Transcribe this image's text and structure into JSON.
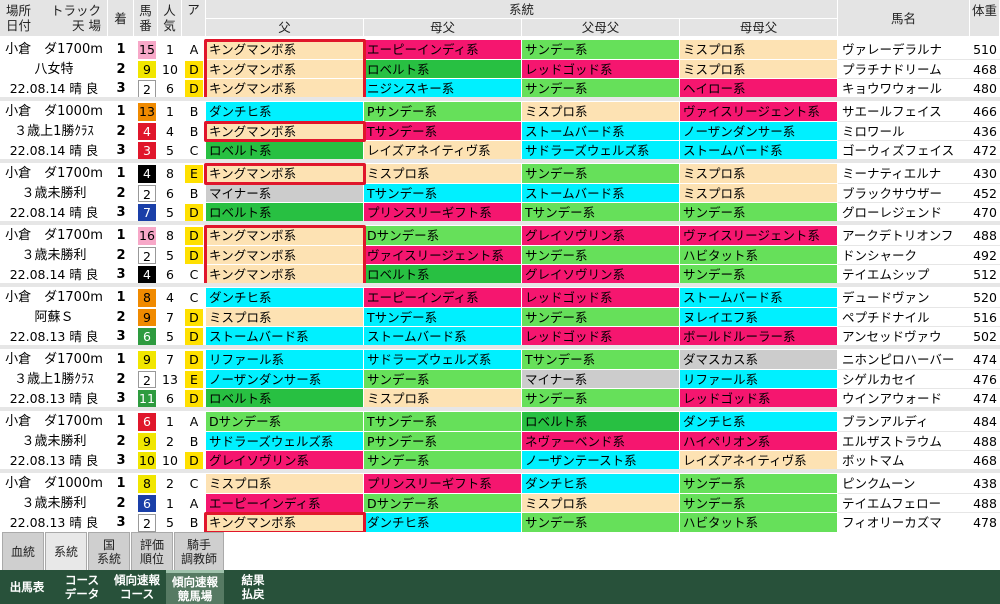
{
  "header": {
    "place": "場所",
    "track": "トラック",
    "date": "日付",
    "weather": "天 場",
    "finish": "着",
    "horse_no": "馬番",
    "popularity": "人気",
    "grade": "ア",
    "lineage": "系統",
    "father": "父",
    "mother_father": "母父",
    "father_mother_father": "父母父",
    "mother_mother_father": "母母父",
    "horse_name": "馬名",
    "weight": "体重"
  },
  "colors": {
    "king": "#fde2b3",
    "green": "#66e05a",
    "magenta": "#f5166f",
    "cyan": "#00f0ff",
    "darkgreen": "#28c042",
    "gray": "#cccccc",
    "highlight": "#e0162b",
    "gate1": "#ffffff",
    "gate2": "#000000",
    "gate3": "#e0162b",
    "gate4": "#1a3fa8",
    "gate5": "#f1e600",
    "gate6": "#2e9b3f",
    "gate7": "#f08a00",
    "gate8": "#f7a8c8",
    "gradeA": "#ffffff",
    "gradeB": "#ffffff",
    "gradeC": "#ffffff",
    "gradeD": "#ffe000",
    "gradeE": "#ffe000"
  },
  "races": [
    {
      "info": [
        "小倉　ダ1700m",
        "八女特",
        "22.08.14 晴 良"
      ],
      "rows": [
        {
          "rank": "1",
          "gate": "8",
          "no": "15",
          "ninki": "1",
          "grade": "A",
          "sire": [
            "キングマンボ系",
            "エーピーインディ系",
            "サンデー系",
            "ミスプロ系"
          ],
          "sc": [
            "king",
            "magenta",
            "green",
            "king"
          ],
          "name": "ヴァレーデラルナ",
          "weight": "510",
          "hl": true
        },
        {
          "rank": "2",
          "gate": "5",
          "no": "9",
          "ninki": "10",
          "grade": "D",
          "sire": [
            "キングマンボ系",
            "ロベルト系",
            "レッドゴッド系",
            "ミスプロ系"
          ],
          "sc": [
            "king",
            "darkgreen",
            "magenta",
            "king"
          ],
          "name": "プラチナドリーム",
          "weight": "468",
          "hl": true
        },
        {
          "rank": "3",
          "gate": "1",
          "no": "2",
          "ninki": "6",
          "grade": "D",
          "sire": [
            "キングマンボ系",
            "ニジンスキー系",
            "サンデー系",
            "ヘイロー系"
          ],
          "sc": [
            "king",
            "cyan",
            "green",
            "magenta"
          ],
          "name": "キョウワウォール",
          "weight": "480",
          "hl": true
        }
      ]
    },
    {
      "info": [
        "小倉　ダ1000m",
        "３歳上1勝ｸﾗｽ",
        "22.08.14 晴 良"
      ],
      "rows": [
        {
          "rank": "1",
          "gate": "7",
          "no": "13",
          "ninki": "1",
          "grade": "B",
          "sire": [
            "ダンチヒ系",
            "Pサンデー系",
            "ミスプロ系",
            "ヴァイスリージェント系"
          ],
          "sc": [
            "cyan",
            "green",
            "king",
            "magenta"
          ],
          "name": "サエールフェイス",
          "weight": "466",
          "hl": false
        },
        {
          "rank": "2",
          "gate": "3",
          "no": "4",
          "ninki": "4",
          "grade": "B",
          "sire": [
            "キングマンボ系",
            "Tサンデー系",
            "ストームバード系",
            "ノーザンダンサー系"
          ],
          "sc": [
            "king",
            "magenta",
            "cyan",
            "cyan"
          ],
          "name": "ミロワール",
          "weight": "436",
          "hl": true
        },
        {
          "rank": "3",
          "gate": "3",
          "no": "3",
          "ninki": "5",
          "grade": "C",
          "sire": [
            "ロベルト系",
            "レイズアネイティヴ系",
            "サドラーズウェルズ系",
            "ストームバード系"
          ],
          "sc": [
            "darkgreen",
            "king",
            "cyan",
            "cyan"
          ],
          "name": "ゴーウィズフェイス",
          "weight": "472",
          "hl": false
        }
      ]
    },
    {
      "info": [
        "小倉　ダ1700m",
        "３歳未勝利",
        "22.08.14 晴 良"
      ],
      "rows": [
        {
          "rank": "1",
          "gate": "2",
          "no": "4",
          "ninki": "8",
          "grade": "E",
          "sire": [
            "キングマンボ系",
            "ミスプロ系",
            "サンデー系",
            "ミスプロ系"
          ],
          "sc": [
            "king",
            "king",
            "green",
            "king"
          ],
          "name": "ミーナティエルナ",
          "weight": "430",
          "hl": true
        },
        {
          "rank": "2",
          "gate": "1",
          "no": "2",
          "ninki": "6",
          "grade": "B",
          "sire": [
            "マイナー系",
            "Tサンデー系",
            "ストームバード系",
            "ミスプロ系"
          ],
          "sc": [
            "gray",
            "cyan",
            "cyan",
            "king"
          ],
          "name": "ブラックサウザー",
          "weight": "452",
          "hl": false
        },
        {
          "rank": "3",
          "gate": "4",
          "no": "7",
          "ninki": "5",
          "grade": "D",
          "sire": [
            "ロベルト系",
            "プリンスリーギフト系",
            "Tサンデー系",
            "サンデー系"
          ],
          "sc": [
            "darkgreen",
            "magenta",
            "green",
            "green"
          ],
          "name": "グローレジェンド",
          "weight": "470",
          "hl": false
        }
      ]
    },
    {
      "info": [
        "小倉　ダ1700m",
        "３歳未勝利",
        "22.08.14 晴 良"
      ],
      "rows": [
        {
          "rank": "1",
          "gate": "8",
          "no": "16",
          "ninki": "8",
          "grade": "D",
          "sire": [
            "キングマンボ系",
            "Dサンデー系",
            "グレイソヴリン系",
            "ヴァイスリージェント系"
          ],
          "sc": [
            "king",
            "green",
            "magenta",
            "magenta"
          ],
          "name": "アークデトリオンフ",
          "weight": "488",
          "hl": true
        },
        {
          "rank": "2",
          "gate": "1",
          "no": "2",
          "ninki": "5",
          "grade": "D",
          "sire": [
            "キングマンボ系",
            "ヴァイスリージェント系",
            "サンデー系",
            "ハビタット系"
          ],
          "sc": [
            "king",
            "magenta",
            "green",
            "green"
          ],
          "name": "ドンシャーク",
          "weight": "492",
          "hl": true
        },
        {
          "rank": "3",
          "gate": "2",
          "no": "4",
          "ninki": "6",
          "grade": "C",
          "sire": [
            "キングマンボ系",
            "ロベルト系",
            "グレイソヴリン系",
            "サンデー系"
          ],
          "sc": [
            "king",
            "darkgreen",
            "magenta",
            "green"
          ],
          "name": "テイエムシップ",
          "weight": "512",
          "hl": true
        }
      ]
    },
    {
      "info": [
        "小倉　ダ1700m",
        "阿蘇Ｓ",
        "22.08.13 晴 良"
      ],
      "rows": [
        {
          "rank": "1",
          "gate": "7",
          "no": "8",
          "ninki": "4",
          "grade": "C",
          "sire": [
            "ダンチヒ系",
            "エーピーインディ系",
            "レッドゴッド系",
            "ストームバード系"
          ],
          "sc": [
            "cyan",
            "magenta",
            "magenta",
            "cyan"
          ],
          "name": "デュードヴァン",
          "weight": "520",
          "hl": false
        },
        {
          "rank": "2",
          "gate": "7",
          "no": "9",
          "ninki": "7",
          "grade": "D",
          "sire": [
            "ミスプロ系",
            "Tサンデー系",
            "サンデー系",
            "ヌレイエフ系"
          ],
          "sc": [
            "king",
            "cyan",
            "green",
            "cyan"
          ],
          "name": "ペプチドナイル",
          "weight": "516",
          "hl": false
        },
        {
          "rank": "3",
          "gate": "6",
          "no": "6",
          "ninki": "5",
          "grade": "D",
          "sire": [
            "ストームバード系",
            "ストームバード系",
            "レッドゴッド系",
            "ボールドルーラー系"
          ],
          "sc": [
            "cyan",
            "cyan",
            "magenta",
            "magenta"
          ],
          "name": "アンセッドヴァウ",
          "weight": "502",
          "hl": false
        }
      ]
    },
    {
      "info": [
        "小倉　ダ1700m",
        "３歳上1勝ｸﾗｽ",
        "22.08.13 晴 良"
      ],
      "rows": [
        {
          "rank": "1",
          "gate": "5",
          "no": "9",
          "ninki": "7",
          "grade": "D",
          "sire": [
            "リファール系",
            "サドラーズウェルズ系",
            "Tサンデー系",
            "ダマスカス系"
          ],
          "sc": [
            "cyan",
            "cyan",
            "green",
            "gray"
          ],
          "name": "ニホンピロハーバー",
          "weight": "474",
          "hl": false
        },
        {
          "rank": "2",
          "gate": "1",
          "no": "2",
          "ninki": "13",
          "grade": "E",
          "sire": [
            "ノーザンダンサー系",
            "サンデー系",
            "マイナー系",
            "リファール系"
          ],
          "sc": [
            "cyan",
            "green",
            "gray",
            "cyan"
          ],
          "name": "シゲルカセイ",
          "weight": "476",
          "hl": false
        },
        {
          "rank": "3",
          "gate": "6",
          "no": "11",
          "ninki": "6",
          "grade": "D",
          "sire": [
            "ロベルト系",
            "ミスプロ系",
            "サンデー系",
            "レッドゴッド系"
          ],
          "sc": [
            "darkgreen",
            "king",
            "green",
            "magenta"
          ],
          "name": "ウインアウォード",
          "weight": "474",
          "hl": false
        }
      ]
    },
    {
      "info": [
        "小倉　ダ1700m",
        "３歳未勝利",
        "22.08.13 晴 良"
      ],
      "rows": [
        {
          "rank": "1",
          "gate": "3",
          "no": "6",
          "ninki": "1",
          "grade": "A",
          "sire": [
            "Dサンデー系",
            "Tサンデー系",
            "ロベルト系",
            "ダンチヒ系"
          ],
          "sc": [
            "green",
            "green",
            "darkgreen",
            "cyan"
          ],
          "name": "ブランアルディ",
          "weight": "484",
          "hl": false
        },
        {
          "rank": "2",
          "gate": "5",
          "no": "9",
          "ninki": "2",
          "grade": "B",
          "sire": [
            "サドラーズウェルズ系",
            "Pサンデー系",
            "ネヴァーベンド系",
            "ハイペリオン系"
          ],
          "sc": [
            "cyan",
            "green",
            "magenta",
            "magenta"
          ],
          "name": "エルザストラウム",
          "weight": "488",
          "hl": false
        },
        {
          "rank": "3",
          "gate": "5",
          "no": "10",
          "ninki": "10",
          "grade": "D",
          "sire": [
            "グレイソヴリン系",
            "サンデー系",
            "ノーザンテースト系",
            "レイズアネイティヴ系"
          ],
          "sc": [
            "magenta",
            "green",
            "cyan",
            "king"
          ],
          "name": "ボットマム",
          "weight": "468",
          "hl": false
        }
      ]
    },
    {
      "info": [
        "小倉　ダ1000m",
        "３歳未勝利",
        "22.08.13 晴 良"
      ],
      "rows": [
        {
          "rank": "1",
          "gate": "5",
          "no": "8",
          "ninki": "2",
          "grade": "C",
          "sire": [
            "ミスプロ系",
            "プリンスリーギフト系",
            "ダンチヒ系",
            "サンデー系"
          ],
          "sc": [
            "king",
            "magenta",
            "cyan",
            "green"
          ],
          "name": "ピンクムーン",
          "weight": "438",
          "hl": false
        },
        {
          "rank": "2",
          "gate": "4",
          "no": "6",
          "ninki": "1",
          "grade": "A",
          "sire": [
            "エーピーインディ系",
            "Dサンデー系",
            "ミスプロ系",
            "サンデー系"
          ],
          "sc": [
            "magenta",
            "green",
            "king",
            "green"
          ],
          "name": "テイエムフェロー",
          "weight": "488",
          "hl": false
        },
        {
          "rank": "3",
          "gate": "1",
          "no": "2",
          "ninki": "5",
          "grade": "B",
          "sire": [
            "キングマンボ系",
            "ダンチヒ系",
            "サンデー系",
            "ハビタット系"
          ],
          "sc": [
            "king",
            "cyan",
            "green",
            "green"
          ],
          "name": "フィオリーカズマ",
          "weight": "478",
          "hl": true
        }
      ]
    }
  ],
  "subtabs": [
    {
      "label": "血統",
      "active": false
    },
    {
      "label": "系統",
      "active": true
    },
    {
      "label": "国\n系統",
      "active": false
    },
    {
      "label": "評価\n順位",
      "active": false
    },
    {
      "label": "騎手\n調教師",
      "active": false
    }
  ],
  "bottomtabs": [
    {
      "label": "出馬表",
      "active": false
    },
    {
      "label": "コース\nデータ",
      "active": false
    },
    {
      "label": "傾向速報\nコース",
      "active": false
    },
    {
      "label": "傾向速報\n競馬場",
      "active": true
    },
    {
      "label": "結果\n払戻",
      "active": false
    }
  ]
}
